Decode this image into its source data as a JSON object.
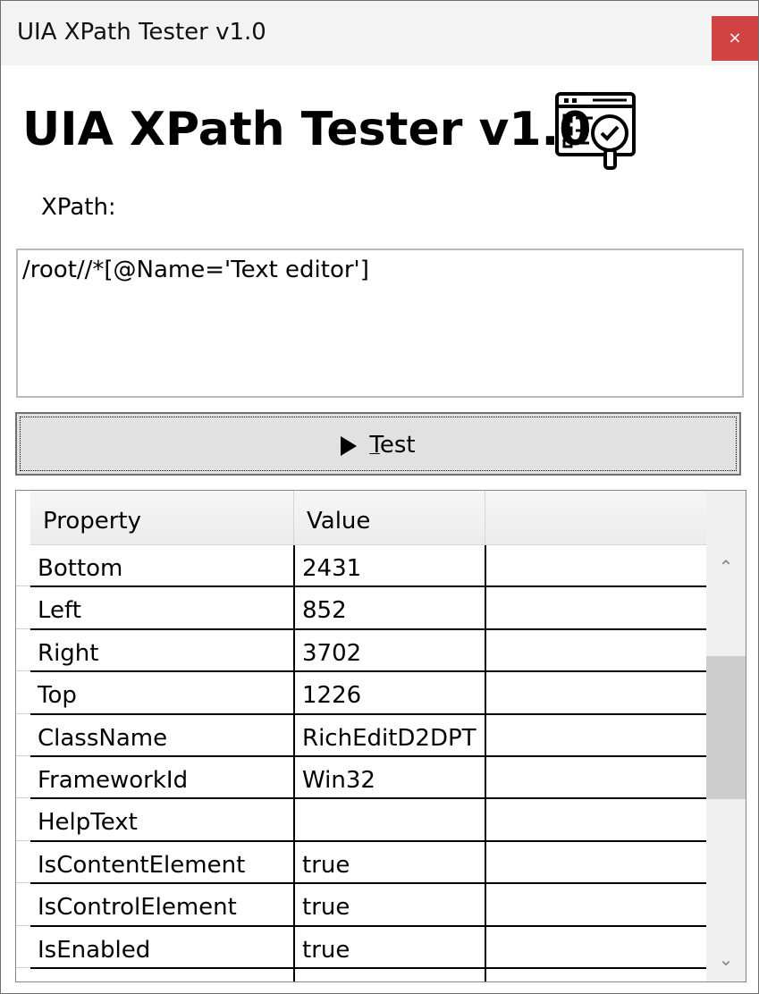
{
  "window": {
    "title": "UIA XPath Tester v1.0",
    "close_glyph": "×",
    "heading": "UIA XPath Tester v1.0",
    "logo_icon": "form-inspect-icon"
  },
  "xpath": {
    "label": "XPath:",
    "value": "/root//*[@Name='Text editor']"
  },
  "test_button": {
    "icon": "play-icon",
    "accel": "T",
    "label_rest": "est"
  },
  "grid": {
    "columns": [
      "Property",
      "Value"
    ],
    "rows": [
      {
        "property": "Bottom",
        "value": "2431"
      },
      {
        "property": "Left",
        "value": "852"
      },
      {
        "property": "Right",
        "value": "3702"
      },
      {
        "property": "Top",
        "value": "1226"
      },
      {
        "property": "ClassName",
        "value": "RichEditD2DPT"
      },
      {
        "property": "FrameworkId",
        "value": "Win32"
      },
      {
        "property": "HelpText",
        "value": ""
      },
      {
        "property": "IsContentElement",
        "value": "true"
      },
      {
        "property": "IsControlElement",
        "value": "true"
      },
      {
        "property": "IsEnabled",
        "value": "true"
      }
    ]
  },
  "colors": {
    "close_button": "#d14242",
    "titlebar": "#f3f3f3",
    "button_face": "#e1e1e1"
  }
}
